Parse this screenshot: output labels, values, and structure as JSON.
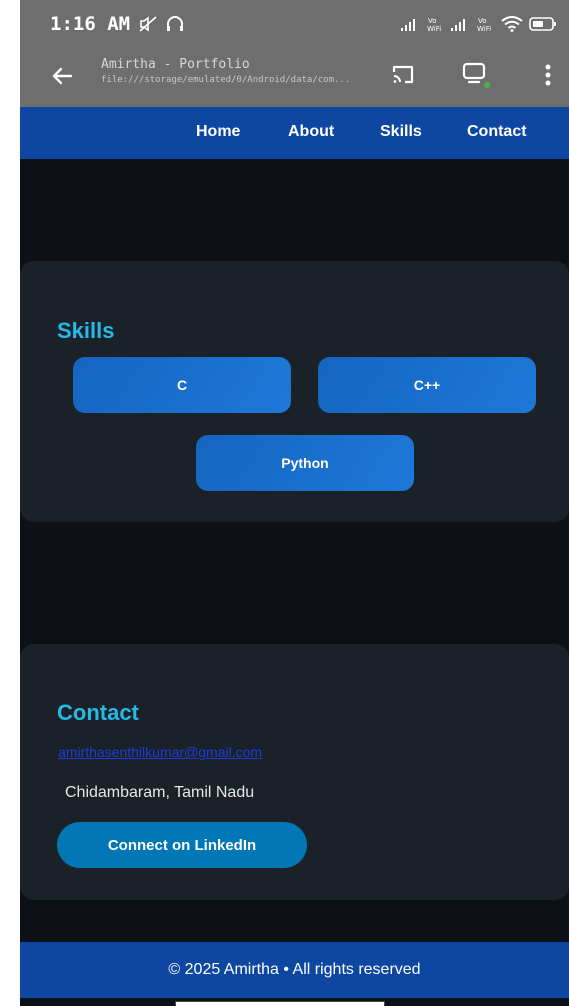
{
  "status_bar": {
    "time": "1:16 AM",
    "indicators": [
      "mute-icon",
      "headphones-icon",
      "signal-icon",
      "vowifi-icon",
      "signal-icon",
      "vowifi-icon",
      "wifi-icon",
      "battery-icon"
    ],
    "vowifi_label_1": "Vo\nWiFi",
    "vowifi_label_2": "Vo\nWiFi"
  },
  "browser": {
    "title": "Amirtha - Portfolio",
    "url": "file:///storage/emulated/0/Android/data/com..."
  },
  "nav": {
    "links": [
      "Home",
      "About",
      "Skills",
      "Contact"
    ]
  },
  "skills": {
    "title": "Skills",
    "items": [
      "C",
      "C++",
      "Python"
    ]
  },
  "contact": {
    "title": "Contact",
    "email": "amirthasenthilkumar@gmail.com",
    "location": "Chidambaram, Tamil Nadu",
    "linkedin_label": "Connect on LinkedIn"
  },
  "footer": {
    "text": "© 2025 Amirtha • All rights reserved"
  },
  "colors": {
    "background": "#0d1117",
    "card": "#1b2129",
    "nav": "#0d47a1",
    "accent": "#26b8e6",
    "skill_button": "#1565c0",
    "linkedin_button": "#0277b5"
  }
}
